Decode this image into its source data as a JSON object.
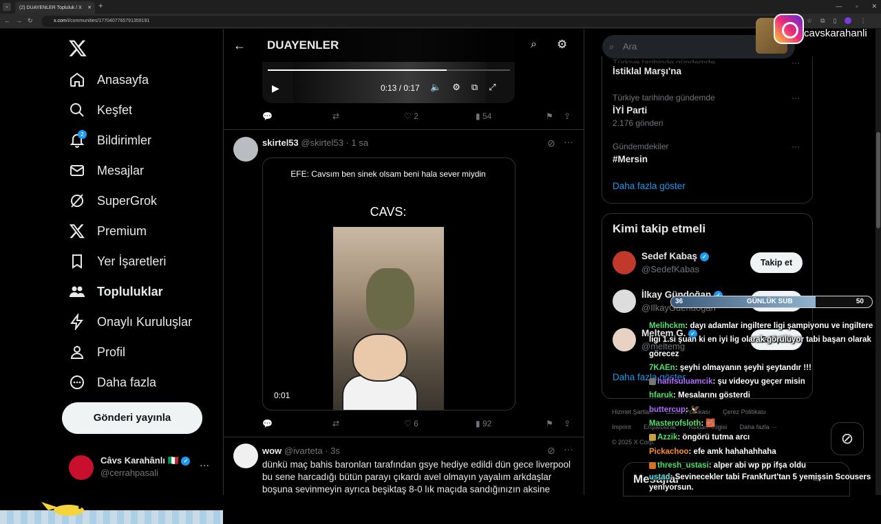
{
  "browser": {
    "tab_title": "(2) DUAYENLER Topluluk / X",
    "tab_close": "✕",
    "new_tab": "+",
    "url_domain": "x.com",
    "url_path": "/i/communities/1770407765791359191",
    "window_controls": [
      "—",
      "▫",
      "✕"
    ]
  },
  "nav": {
    "items": [
      {
        "label": "Anasayfa",
        "icon": "home-icon"
      },
      {
        "label": "Keşfet",
        "icon": "search-icon"
      },
      {
        "label": "Bildirimler",
        "icon": "bell-icon",
        "badge": "2"
      },
      {
        "label": "Mesajlar",
        "icon": "mail-icon"
      },
      {
        "label": "SuperGrok",
        "icon": "grok-icon"
      },
      {
        "label": "Premium",
        "icon": "x-icon"
      },
      {
        "label": "Yer İşaretleri",
        "icon": "bookmark-icon"
      },
      {
        "label": "Topluluklar",
        "icon": "people-icon"
      },
      {
        "label": "Onaylı Kuruluşlar",
        "icon": "lightning-icon"
      },
      {
        "label": "Profil",
        "icon": "person-icon"
      },
      {
        "label": "Daha fazla",
        "icon": "more-circle-icon"
      }
    ],
    "post_button": "Gönderi yayınla",
    "account": {
      "name": "Câvs Karahânlı 🇮🇹",
      "handle": "@cerrahpasali",
      "more": "···"
    }
  },
  "main": {
    "title": "DUAYENLER",
    "video1": {
      "time": "0:13 / 0:17",
      "progress": 0.74
    },
    "tweet1_actions": {
      "reply": "",
      "repost": "",
      "likes": "2",
      "views": "54"
    },
    "tweet2": {
      "name": "skirtel53",
      "handle_time": "@skirtel53 · 1 sa",
      "caption": "EFE: Cavsım ben sinek olsam beni hala sever miydin",
      "cavs": "CAVS:",
      "duration": "0:01",
      "likes": "6",
      "views": "92"
    },
    "tweet3": {
      "name": "wow",
      "handle_time": "@ivarteta · 3s",
      "text": "dünkü maç bahis baronları tarafından gsye hediye edildi dün gece liverpool bu sene harcadığı bütün parayı çıkardı avel olmayın yayalım arkdaşlar boşuna sevinmeyin ayrıca beşiktaş 8-0 lık maçıda sandığınızın aksine"
    }
  },
  "right": {
    "search_placeholder": "Ara",
    "trends": [
      {
        "context": "Türkiye tarihinde gündemde",
        "title": "İstiklal Marşı'na",
        "count": ""
      },
      {
        "context": "Türkiye tarihinde gündemde",
        "title": "İYİ Parti",
        "count": "2.176 gönderi"
      },
      {
        "context": "Gündemdekiler",
        "title": "#Mersin",
        "count": ""
      }
    ],
    "show_more": "Daha fazla göster",
    "who_to_follow": {
      "title": "Kimi takip etmeli",
      "follow_label": "Takip et",
      "users": [
        {
          "name": "Sedef Kabaş",
          "handle": "@SedefKabas"
        },
        {
          "name": "İlkay Gündoğan",
          "handle": "@IlkayGuendogan"
        },
        {
          "name": "Meltem G.",
          "handle": "@meltemg"
        }
      ],
      "more": "Daha fazla göster"
    },
    "footer": [
      "Hizmet Şartları",
      "Gizlilik Politikası",
      "Çerez Politikası",
      "Imprint",
      "Erişilebilirlik",
      "Reklam bilgisi",
      "Daha fazla ···",
      "© 2025 X Corp."
    ],
    "messages_label": "Mesajlar"
  },
  "overlay": {
    "instagram_name": "cavskarahanli",
    "sub_bar": {
      "low": "36",
      "label": "GÜNLÜK SUB",
      "high": "50"
    },
    "chat": [
      {
        "user": "Melihckm",
        "msg": ": dayı adamlar ingiltere ligi şampiyonu ve ingiltere ligi 1.si şuan ki en iyi lig olarak görülüyor tabi başarı olarak görecez",
        "color": "u1"
      },
      {
        "user": "7KAEn",
        "msg": ": şeyhi olmayanın şeyhi şeytandır !!!",
        "color": "u1"
      },
      {
        "user": "hafifsuluamcik",
        "msg": ": şu videoyu geçer misin",
        "color": "u2"
      },
      {
        "user": "hfaruk",
        "msg": ": Mesalarını gösterdi",
        "color": "u1"
      },
      {
        "user": "buttercup",
        "msg": ": 🦅",
        "color": "u2"
      },
      {
        "user": "Masterofsloth",
        "msg": ": 🧱",
        "color": "u1"
      },
      {
        "user": "Azzik",
        "msg": ": öngörü tutma arcı",
        "color": "u1"
      },
      {
        "user": "Pickachoo",
        "msg": ": efe amk hahahahhaha",
        "color": "u3"
      },
      {
        "user": "thresh_ustasi",
        "msg": ": alper abi wp pp ifşa oldu",
        "color": "u1"
      },
      {
        "user": "ustad",
        "msg": ": Sevinecekler tabi Frankfurt'tan 5 yemişsin Scousers yeniyorsun.",
        "color": "u4"
      }
    ]
  }
}
